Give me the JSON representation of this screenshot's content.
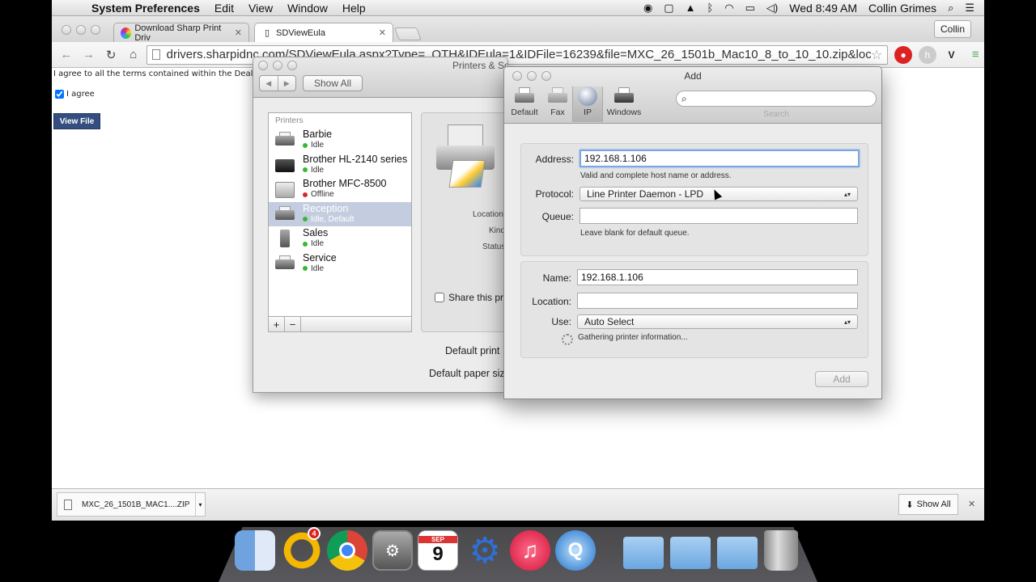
{
  "menubar": {
    "app": "System Preferences",
    "menus": [
      "Edit",
      "View",
      "Window",
      "Help"
    ],
    "clock": "Wed 8:49 AM",
    "user": "Collin Grimes"
  },
  "browser": {
    "tabs": [
      {
        "label": "Download Sharp Print Driv"
      },
      {
        "label": "SDViewEula"
      }
    ],
    "profile": "Collin",
    "url": "drivers.sharpidnc.com/SDViewEula.aspx?Type=_OTH&IDEula=1&IDFile=16239&file=MXC_26_1501b_Mac10_8_to_10_10.zip&location=%...",
    "page": {
      "agree_text": "I agree to all the terms contained within the Dealer us",
      "checkbox_label": "I agree",
      "view_file": "View File"
    },
    "download": {
      "filename": "MXC_26_1501B_MAC1....ZIP",
      "show_all": "Show All"
    }
  },
  "syspref": {
    "title": "Printers & Scanners",
    "show_all": "Show All",
    "list_header": "Printers",
    "printers": [
      {
        "name": "Barbie",
        "status": "Idle"
      },
      {
        "name": "Brother HL-2140 series",
        "status": "Idle"
      },
      {
        "name": "Brother MFC-8500",
        "status": "Offline"
      },
      {
        "name": "Reception",
        "status": "Idle, Default"
      },
      {
        "name": "Sales",
        "status": "Idle"
      },
      {
        "name": "Service",
        "status": "Idle"
      }
    ],
    "add_symbol": "+",
    "remove_symbol": "−",
    "detail": {
      "location_label": "Location",
      "kind_label": "Kind",
      "status_label": "Status"
    },
    "share_label": "Share this pr",
    "default_printer_label": "Default print",
    "default_paper_label": "Default paper siz"
  },
  "add_dialog": {
    "title": "Add",
    "toolbar": [
      {
        "label": "Default"
      },
      {
        "label": "Fax"
      },
      {
        "label": "IP"
      },
      {
        "label": "Windows"
      }
    ],
    "search_label": "Search",
    "address_label": "Address:",
    "address_value": "192.168.1.106",
    "address_help": "Valid and complete host name or address.",
    "protocol_label": "Protocol:",
    "protocol_value": "Line Printer Daemon - LPD",
    "queue_label": "Queue:",
    "queue_value": "",
    "queue_help": "Leave blank for default queue.",
    "name_label": "Name:",
    "name_value": "192.168.1.106",
    "location_label": "Location:",
    "location_value": "",
    "use_label": "Use:",
    "use_value": "Auto Select",
    "gathering_text": "Gathering printer information...",
    "add_button": "Add"
  },
  "dock": {
    "calendar_month": "SEP",
    "calendar_day": "9",
    "mail_badge": "4"
  }
}
